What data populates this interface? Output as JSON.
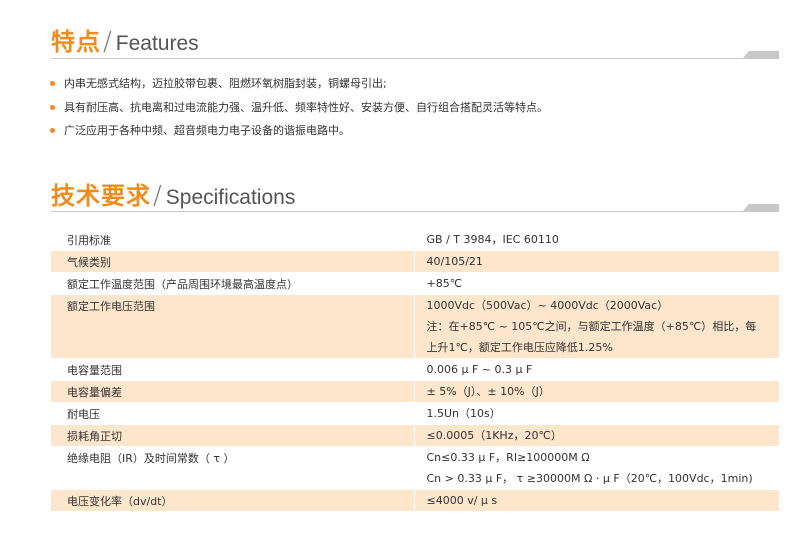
{
  "features_section": {
    "title_cn": "特点",
    "slash": "/",
    "title_en": "Features",
    "items": [
      "内串无感式结构，迈拉胶带包裹、阻燃环氧树脂封装，铜螺母引出;",
      "具有耐压高、抗电离和过电流能力强、温升低、频率特性好、安装方便、自行组合搭配灵活等特点。",
      "广泛应用于各种中频、超音频电力电子设备的谐振电路中。"
    ]
  },
  "spec_section": {
    "title_cn": "技术要求",
    "slash": "/",
    "title_en": "Specifications",
    "rows": [
      {
        "label": "引用标准",
        "values": [
          "GB / T 3984，IEC 60110"
        ]
      },
      {
        "label": "气候类别",
        "values": [
          "40/105/21"
        ]
      },
      {
        "label": "额定工作温度范围（产品周围环境最高温度点）",
        "values": [
          "+85℃"
        ]
      },
      {
        "label": "额定工作电压范围",
        "values": [
          "1000Vdc（500Vac）~ 4000Vdc（2000Vac）",
          "注：在+85℃ ~ 105℃之间，与额定工作温度（+85℃）相比，每",
          "上升1℃，额定工作电压应降低1.25%"
        ]
      },
      {
        "label": "电容量范围",
        "values": [
          "0.006 μ F ~ 0.3 μ F"
        ]
      },
      {
        "label": "电容量偏差",
        "values": [
          "± 5%（J）、± 10%（J）"
        ]
      },
      {
        "label": "耐电压",
        "values": [
          "1.5Un（10s）"
        ]
      },
      {
        "label": "损耗角正切",
        "values": [
          "≤0.0005（1KHz，20℃）"
        ]
      },
      {
        "label": "绝缘电阻（IR）及时间常数（ τ ）",
        "values": [
          "Cn≤0.33 μ F，RI≥100000M Ω",
          "Cn > 0.33 μ F， τ ≥30000M Ω · μ F（20℃，100Vdc，1min)"
        ]
      },
      {
        "label": "电压变化率（dv/dt）",
        "values": [
          "≤4000 v/ μ s"
        ]
      }
    ]
  },
  "colors": {
    "accent": "#f08c1e",
    "band": "#fde6cc",
    "rule": "#c8c8c8"
  }
}
